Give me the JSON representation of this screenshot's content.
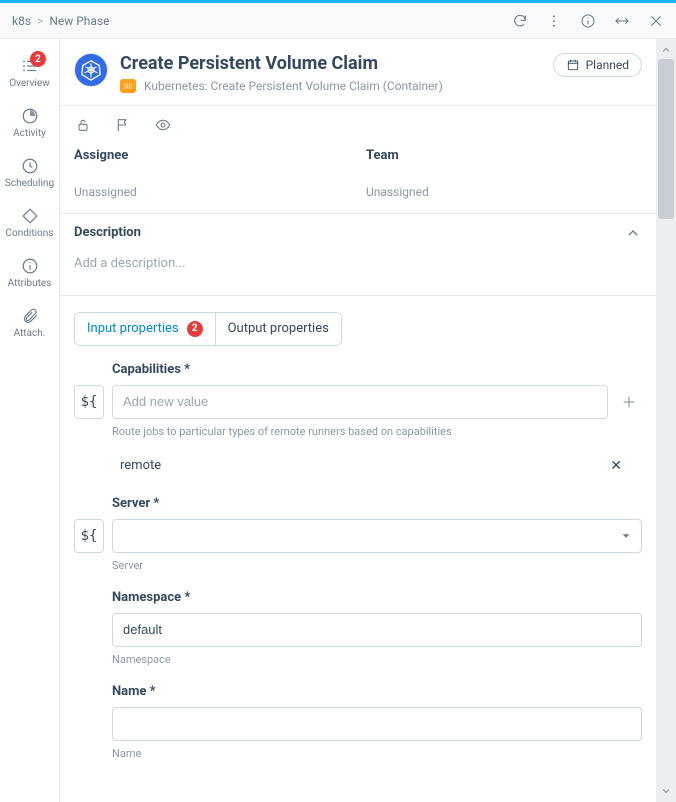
{
  "breadcrumbs": {
    "root": "k8s",
    "leaf": "New Phase"
  },
  "status_label": "Planned",
  "page": {
    "title": "Create Persistent Volume Claim",
    "subtitle": "Kubernetes: Create Persistent Volume Claim (Container)"
  },
  "rail": {
    "overview": {
      "label": "Overview",
      "badge": "2"
    },
    "activity": {
      "label": "Activity"
    },
    "scheduling": {
      "label": "Scheduling"
    },
    "conditions": {
      "label": "Conditions"
    },
    "attributes": {
      "label": "Attributes"
    },
    "attach": {
      "label": "Attach."
    }
  },
  "assign": {
    "assignee_label": "Assignee",
    "assignee_value": "Unassigned",
    "team_label": "Team",
    "team_value": "Unassigned"
  },
  "description": {
    "label": "Description",
    "placeholder": "Add a description..."
  },
  "tabs": {
    "input": "Input properties",
    "input_badge": "2",
    "output": "Output properties"
  },
  "form": {
    "capabilities": {
      "label": "Capabilities *",
      "placeholder": "Add new value",
      "help": "Route jobs to particular types of remote runners based on capabilities",
      "values": [
        "remote"
      ]
    },
    "server": {
      "label": "Server *",
      "help": "Server",
      "value": ""
    },
    "namespace": {
      "label": "Namespace *",
      "help": "Namespace",
      "value": "default"
    },
    "name": {
      "label": "Name *",
      "help": "Name",
      "value": ""
    }
  },
  "var_chip_label": "${"
}
